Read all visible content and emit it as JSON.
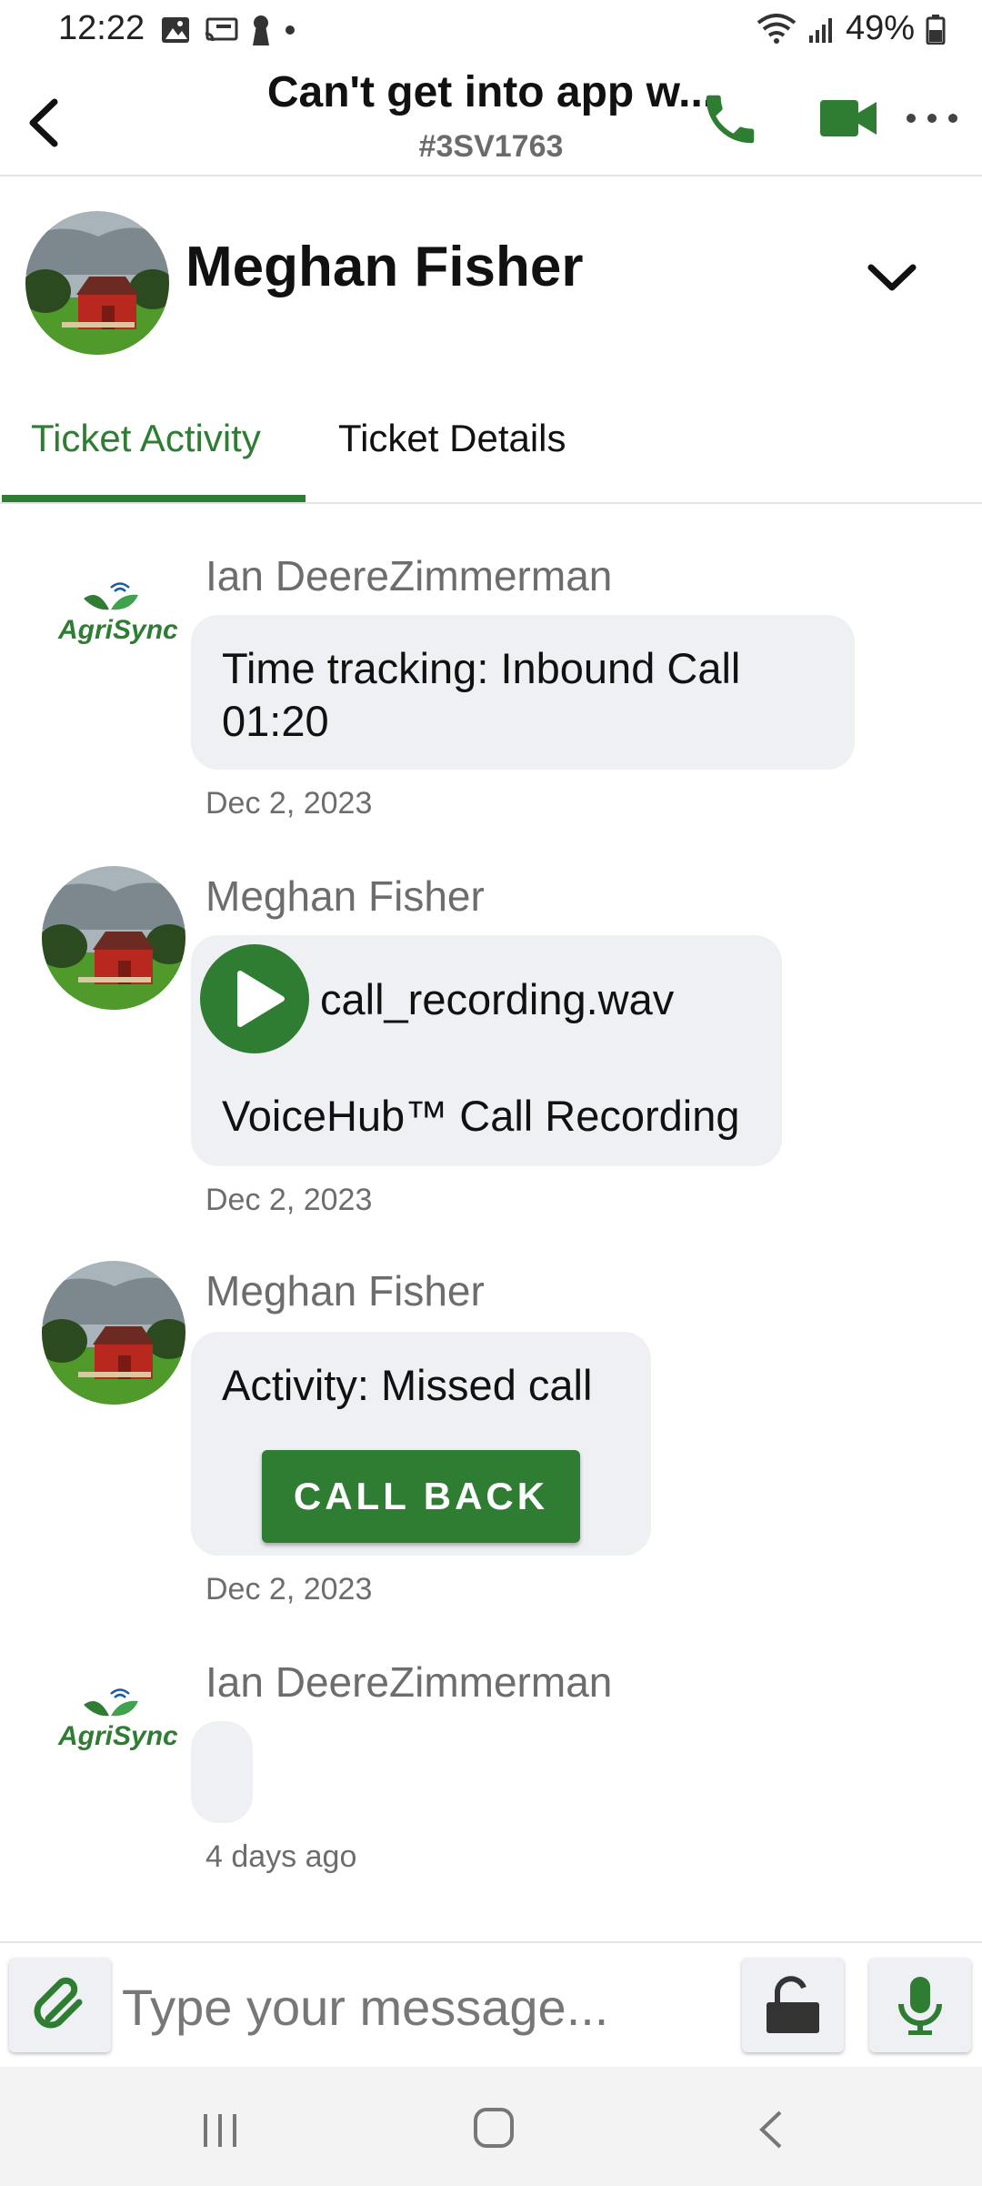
{
  "status_bar": {
    "time": "12:22",
    "battery": "49%"
  },
  "header": {
    "title": "Can't get into app w...",
    "ticket_id": "#3SV1763"
  },
  "contact": {
    "name": "Meghan Fisher"
  },
  "tabs": [
    {
      "label": "Ticket Activity",
      "active": true
    },
    {
      "label": "Ticket Details",
      "active": false
    }
  ],
  "messages": [
    {
      "sender": "Ian DeereZimmerman",
      "avatar": "agrisync-logo",
      "logo_text": "AgriSync",
      "text": "Time tracking: Inbound Call 01:20",
      "date": "Dec 2, 2023"
    },
    {
      "sender": "Meghan Fisher",
      "avatar": "barn-photo",
      "attachment_name": "call_recording.wav",
      "text": "VoiceHub™ Call Recording",
      "date": "Dec 2, 2023"
    },
    {
      "sender": "Meghan Fisher",
      "avatar": "barn-photo",
      "text": "Activity: Missed call",
      "button_label": "CALL BACK",
      "date": "Dec 2, 2023"
    },
    {
      "sender": "Ian DeereZimmerman",
      "avatar": "agrisync-logo",
      "logo_text": "AgriSync",
      "text": "",
      "date": "4 days ago"
    }
  ],
  "composer": {
    "placeholder": "Type your message..."
  },
  "colors": {
    "accent": "#2e7d32",
    "bubble": "#eef0f4",
    "muted_text": "#6d6d6d"
  }
}
